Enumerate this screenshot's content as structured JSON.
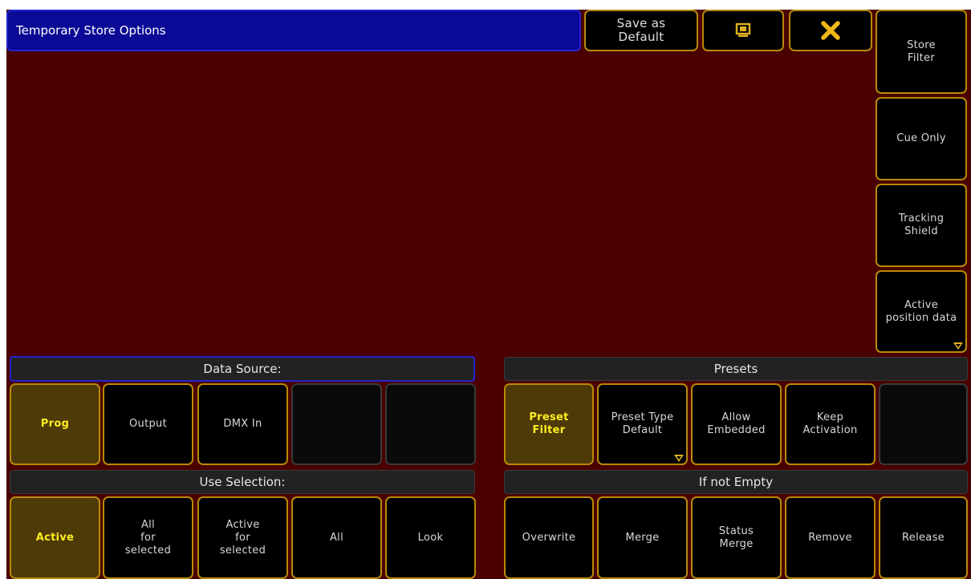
{
  "window": {
    "title": "Temporary Store Options"
  },
  "header": {
    "save_default_label": "Save as\nDefault",
    "screen_icon": "screen-icon",
    "close_icon": "close-icon"
  },
  "right_panel": {
    "store_filter": "Store\nFilter",
    "cue_only": "Cue Only",
    "tracking_shield": "Tracking\nShield",
    "active_position_data": "Active\nposition data"
  },
  "data_source": {
    "label": "Data Source:",
    "options": [
      "Prog",
      "Output",
      "DMX In",
      "",
      ""
    ],
    "active_index": 0
  },
  "presets": {
    "label": "Presets",
    "options": [
      "Preset\nFilter",
      "Preset Type\nDefault",
      "Allow\nEmbedded",
      "Keep\nActivation",
      ""
    ],
    "active_index": 0
  },
  "use_selection": {
    "label": "Use Selection:",
    "options": [
      "Active",
      "All\nfor\nselected",
      "Active\nfor\nselected",
      "All",
      "Look"
    ],
    "active_index": 0
  },
  "if_not_empty": {
    "label": "If not Empty",
    "options": [
      "Overwrite",
      "Merge",
      "Status\nMerge",
      "Remove",
      "Release"
    ]
  },
  "colors": {
    "background": "#4a0000",
    "title_bar": "#0a0a96",
    "button_border": "#b88a08",
    "active_fill": "#4e3a06",
    "active_text": "#ffee22"
  }
}
